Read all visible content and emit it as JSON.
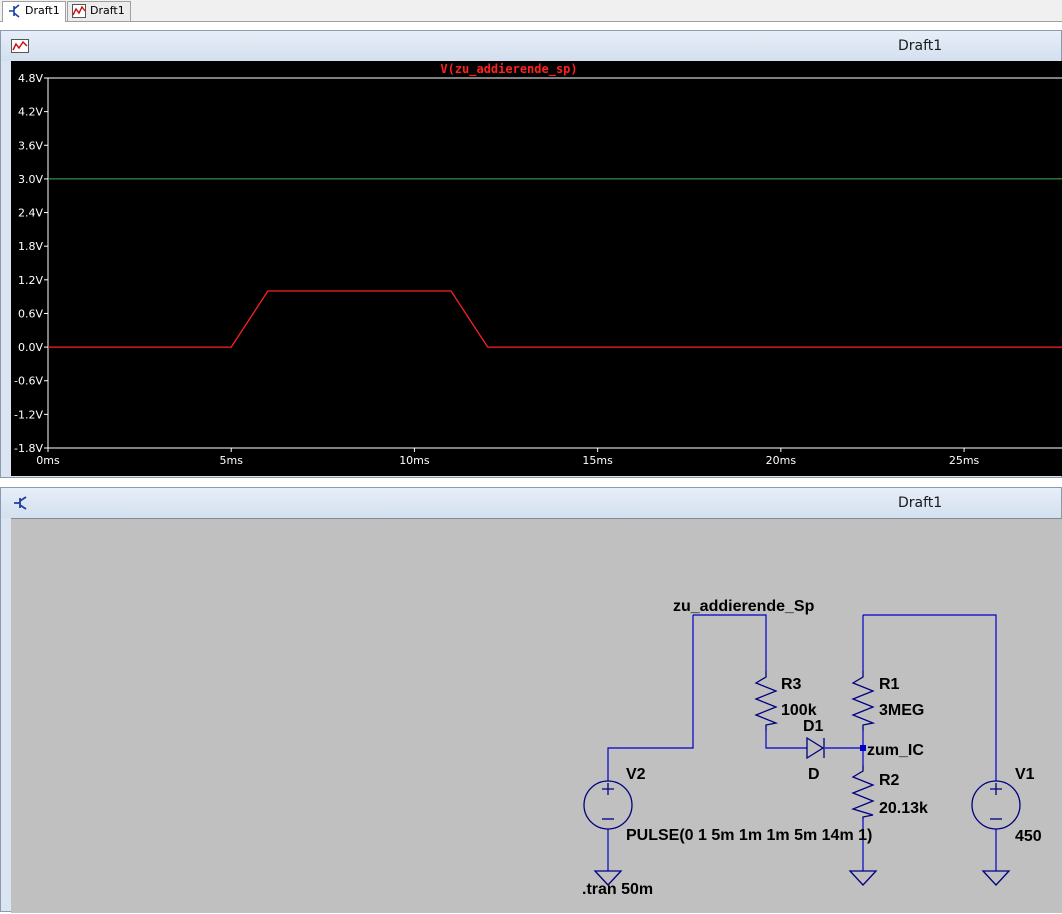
{
  "tabs": [
    {
      "label": "Draft1",
      "icon": "schematic-icon",
      "active": true
    },
    {
      "label": "Draft1",
      "icon": "waveform-icon",
      "active": false
    }
  ],
  "plot_window": {
    "title": "Draft1",
    "trace_label": "V(zu_addierende_sp)",
    "trace_color": "#ff2020",
    "cursor_color": "#3cb44b"
  },
  "schematic_window": {
    "title": "Draft1",
    "wire_color": "#0000c8",
    "nets": {
      "input": "zu_addierende_Sp",
      "output": "zum_IC"
    },
    "components": {
      "r3": {
        "name": "R3",
        "value": "100k"
      },
      "r1": {
        "name": "R1",
        "value": "3MEG"
      },
      "r2": {
        "name": "R2",
        "value": "20.13k"
      },
      "d1": {
        "name": "D1",
        "value": "D"
      },
      "v2": {
        "name": "V2",
        "value": "PULSE(0 1 5m 1m 1m 5m 14m 1)"
      },
      "v1": {
        "name": "V1",
        "value": "450"
      }
    },
    "directive": ".tran 50m"
  },
  "chart_data": {
    "type": "line",
    "title": "V(zu_addierende_sp)",
    "xlabel": "",
    "ylabel": "",
    "xlim": [
      0,
      27.7
    ],
    "ylim": [
      -1.8,
      4.8
    ],
    "x_ticks": [
      0,
      5,
      10,
      15,
      20,
      25
    ],
    "x_tick_labels": [
      "0ms",
      "5ms",
      "10ms",
      "15ms",
      "20ms",
      "25ms"
    ],
    "y_ticks": [
      4.8,
      4.2,
      3.6,
      3.0,
      2.4,
      1.8,
      1.2,
      0.6,
      0.0,
      -0.6,
      -1.2,
      -1.8
    ],
    "y_tick_labels": [
      "4.8V",
      "4.2V",
      "3.6V",
      "3.0V",
      "2.4V",
      "1.8V",
      "1.2V",
      "0.6V",
      "0.0V",
      "-0.6V",
      "-1.2V",
      "-1.8V"
    ],
    "grid": false,
    "series": [
      {
        "name": "V(zu_addierende_sp)",
        "x": [
          0,
          5,
          6,
          11,
          12,
          27.7
        ],
        "y": [
          0,
          0,
          1,
          1,
          0,
          0
        ]
      }
    ],
    "reference_lines": [
      {
        "y": 3.0
      }
    ]
  }
}
